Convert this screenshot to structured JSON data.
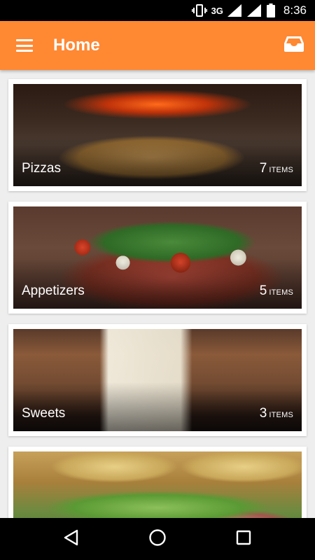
{
  "status_bar": {
    "network": "3G",
    "time": "8:36"
  },
  "app_bar": {
    "title": "Home",
    "menu_icon": "hamburger-menu-icon",
    "action_icon": "inbox-tray-icon",
    "color": "#ff8833"
  },
  "categories": [
    {
      "label": "Pizzas",
      "count": "7",
      "unit": "ITEMS",
      "image": "pizza-photo"
    },
    {
      "label": "Appetizers",
      "count": "5",
      "unit": "ITEMS",
      "image": "appetizer-photo"
    },
    {
      "label": "Sweets",
      "count": "3",
      "unit": "ITEMS",
      "image": "sweets-photo"
    },
    {
      "label": "",
      "count": "",
      "unit": "",
      "image": "sandwich-photo"
    }
  ],
  "nav_bar": {
    "icons": [
      "back-triangle-icon",
      "home-circle-icon",
      "recents-square-icon"
    ]
  }
}
